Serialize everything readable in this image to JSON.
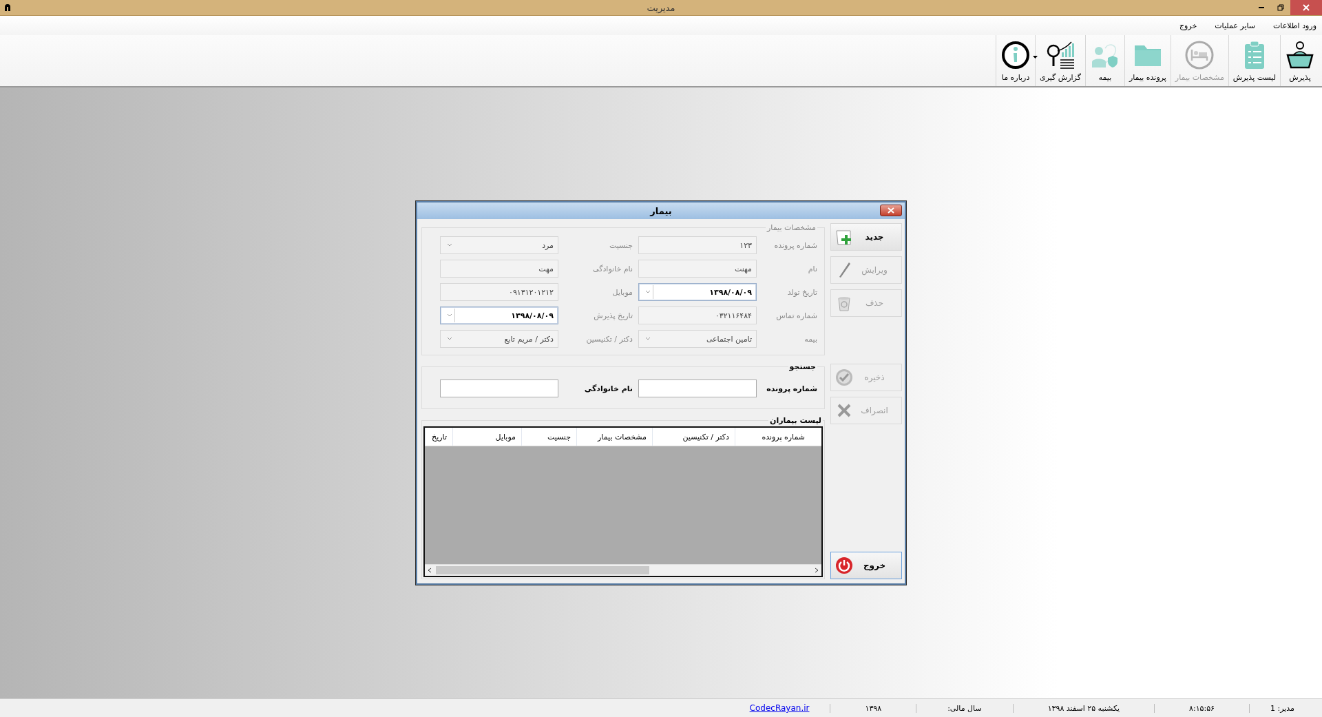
{
  "app_window": {
    "title": "مدیریت"
  },
  "menu": [
    {
      "label": "ورود اطلاعات"
    },
    {
      "label": "سایر عملیات"
    },
    {
      "label": "خروج"
    }
  ],
  "toolbar": [
    {
      "label": "پذیرش",
      "kind": "reception",
      "disabled": false,
      "dropdown": false
    },
    {
      "label": "لیست پذیرش",
      "kind": "clipboard",
      "disabled": false,
      "dropdown": false
    },
    {
      "label": "مشخصات بیمار",
      "kind": "bed",
      "disabled": true,
      "dropdown": false
    },
    {
      "label": "پرونده بیمار",
      "kind": "folder",
      "disabled": false,
      "dropdown": false
    },
    {
      "label": "بیمه",
      "kind": "insurance",
      "disabled": false,
      "dropdown": false
    },
    {
      "label": "گزارش گیری",
      "kind": "report",
      "disabled": false,
      "dropdown": true
    },
    {
      "label": "درباره ما",
      "kind": "info",
      "disabled": false,
      "dropdown": false
    }
  ],
  "dialog": {
    "title": "بیمار",
    "details": {
      "legend": "مشخصات بیمار",
      "fields": [
        {
          "label": "شماره پرونده",
          "kind": "text",
          "value": "۱۲۳"
        },
        {
          "label": "جنسیت",
          "kind": "combo",
          "value": "مرد"
        },
        {
          "label": "نام",
          "kind": "text",
          "value": "مهنت"
        },
        {
          "label": "نام خانوادگی",
          "kind": "text",
          "value": "مهت"
        },
        {
          "label": "تاریخ تولد",
          "kind": "date",
          "value": "۱۳۹۸/۰۸/۰۹"
        },
        {
          "label": "موبایل",
          "kind": "text",
          "value": "۰۹۱۳۱۲۰۱۲۱۲"
        },
        {
          "label": "شماره تماس",
          "kind": "text",
          "value": "۰۳۲۱۱۶۴۸۴"
        },
        {
          "label": "تاریخ پذیرش",
          "kind": "date",
          "value": "۱۳۹۸/۰۸/۰۹"
        },
        {
          "label": "بیمه",
          "kind": "combo",
          "value": "تامین اجتماعی"
        },
        {
          "label": "دکتر / تکنیسین",
          "kind": "combo",
          "value": "دکتر / مریم تابع"
        }
      ]
    },
    "search": {
      "legend": "جستجو",
      "fields": [
        {
          "label": "شماره پرونده"
        },
        {
          "label": "نام خانوادگی"
        }
      ]
    },
    "patients": {
      "legend": "لیست بیماران",
      "columns": [
        "شماره پرونده",
        "دکتر / تکنیسین",
        "مشخصات بیمار",
        "جنسیت",
        "موبایل",
        "تاریخ"
      ]
    },
    "buttons": [
      {
        "label": "جدید",
        "kind": "new",
        "disabled": false
      },
      {
        "label": "ویرایش",
        "kind": "edit",
        "disabled": true
      },
      {
        "label": "حذف",
        "kind": "delete",
        "disabled": true
      },
      {
        "label": "ذخیره",
        "kind": "save",
        "disabled": true
      },
      {
        "label": "انصراف",
        "kind": "cancel",
        "disabled": true
      },
      {
        "label": "خروج",
        "kind": "exit",
        "disabled": false
      }
    ]
  },
  "status_bar": [
    {
      "kind": "text",
      "text": "مدیر:  1"
    },
    {
      "kind": "text",
      "text": "۸:۱۵:۵۶"
    },
    {
      "kind": "text",
      "text": "یکشنبه ۲۵ اسفند ۱۳۹۸"
    },
    {
      "kind": "text",
      "text": "سال مالی:"
    },
    {
      "kind": "text",
      "text": "۱۳۹۸"
    },
    {
      "kind": "link",
      "text": "CodecRayan.ir"
    }
  ]
}
